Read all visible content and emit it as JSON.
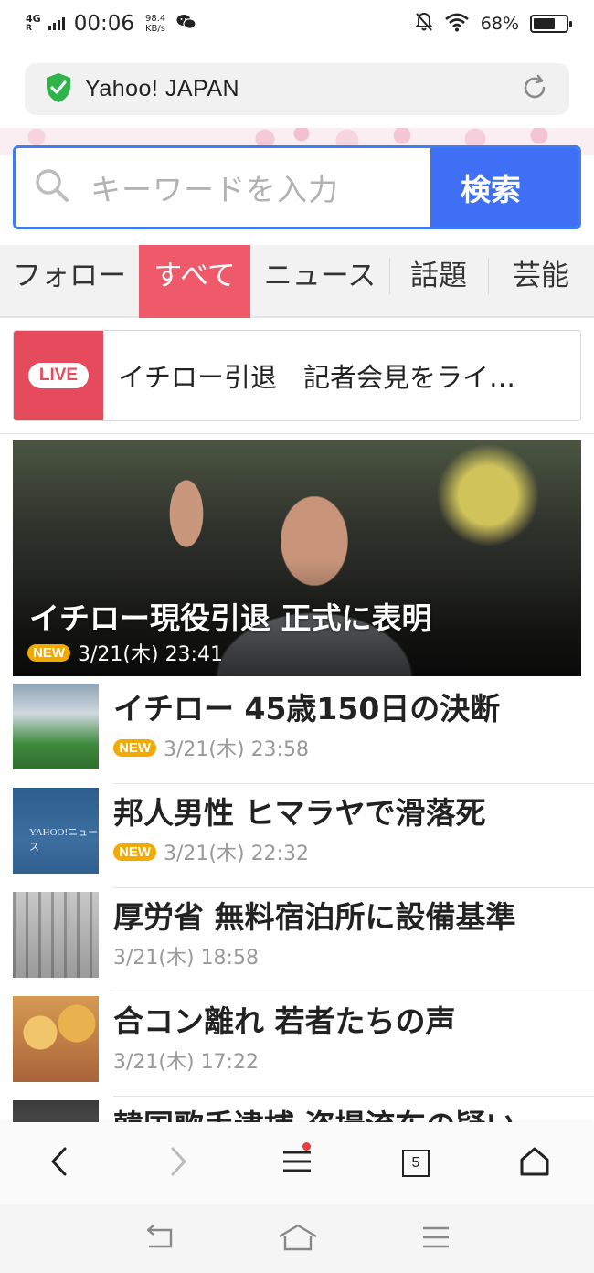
{
  "status_bar": {
    "network": "4G",
    "time": "00:06",
    "speed_value": "98.4",
    "speed_unit": "KB/s",
    "battery": "68%",
    "battery_level": 0.68
  },
  "url_bar": {
    "site_title": "Yahoo! JAPAN",
    "secure_icon": "shield-check-icon",
    "reload_icon": "reload-icon"
  },
  "search": {
    "placeholder": "キーワードを入力",
    "button_label": "検索"
  },
  "tabs": [
    {
      "label": "フォロー",
      "active": false
    },
    {
      "label": "すべて",
      "active": true
    },
    {
      "label": "ニュース",
      "active": false
    },
    {
      "label": "話題",
      "active": false
    },
    {
      "label": "芸能",
      "active": false
    }
  ],
  "live": {
    "badge": "LIVE",
    "text": "イチロー引退　記者会見をライ…"
  },
  "hero": {
    "title": "イチロー現役引退 正式に表明",
    "badge": "NEW",
    "date": "3/21(木) 23:41"
  },
  "news": [
    {
      "title": "イチロー 45歳150日の決断",
      "badge": "NEW",
      "date": "3/21(木) 23:58"
    },
    {
      "title": "邦人男性 ヒマラヤで滑落死",
      "badge": "NEW",
      "date": "3/21(木) 22:32",
      "thumb_text": "YAHOO!ニュース"
    },
    {
      "title": "厚労省 無料宿泊所に設備基準",
      "badge": "",
      "date": "3/21(木) 18:58"
    },
    {
      "title": "合コン離れ 若者たちの声",
      "badge": "",
      "date": "3/21(木) 17:22"
    },
    {
      "title": "韓国歌手逮捕 盗撮流布の疑い",
      "badge": "",
      "date": ""
    }
  ],
  "toolbar": {
    "tab_count": "5"
  },
  "colors": {
    "accent_blue": "#3f6ff4",
    "active_tab": "#ee5a6a",
    "live_red": "#e54b5c",
    "new_badge": "#f2a900",
    "secure_green": "#2fb34a"
  }
}
